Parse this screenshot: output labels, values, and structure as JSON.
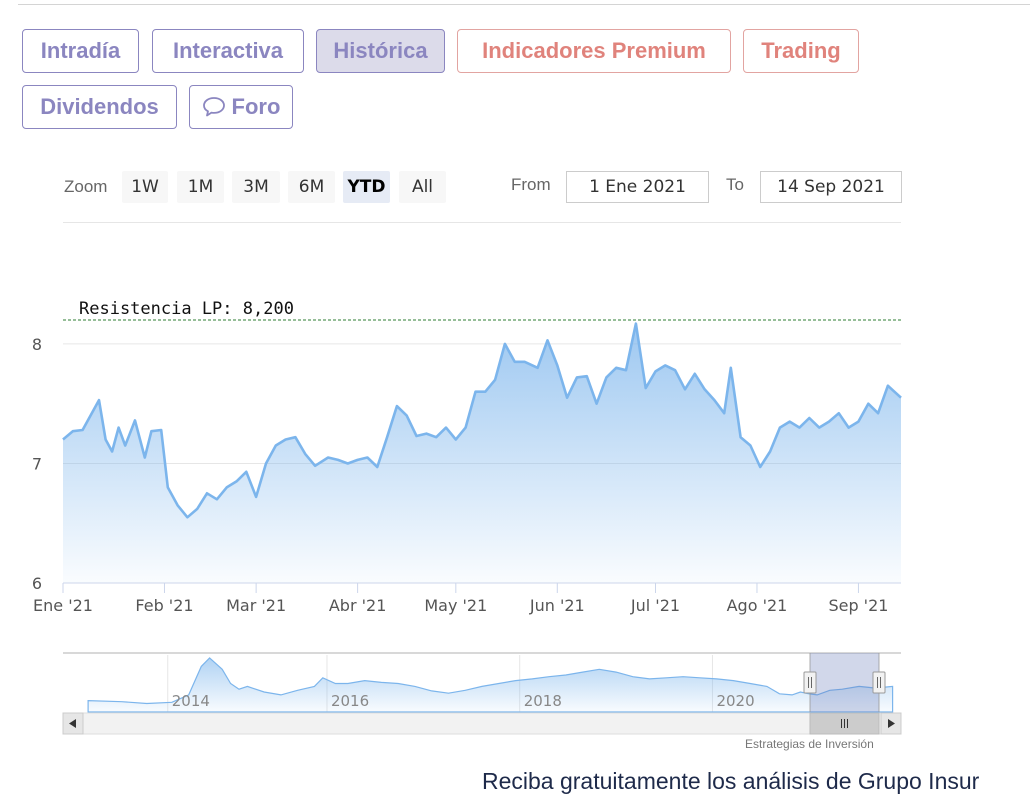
{
  "tabs": [
    {
      "label": "Intradía",
      "kind": "normal"
    },
    {
      "label": "Interactiva",
      "kind": "normal"
    },
    {
      "label": "Histórica",
      "kind": "active"
    },
    {
      "label": "Indicadores Premium",
      "kind": "premium"
    },
    {
      "label": "Trading",
      "kind": "premium"
    },
    {
      "label": "Dividendos",
      "kind": "normal"
    },
    {
      "label": "Foro",
      "kind": "normal",
      "icon": "chat-bubble-icon"
    }
  ],
  "range_selector": {
    "zoom_label": "Zoom",
    "buttons": [
      "1W",
      "1M",
      "3M",
      "6M",
      "YTD",
      "All"
    ],
    "selected": "YTD",
    "from_label": "From",
    "from_value": "1 Ene 2021",
    "to_label": "To",
    "to_value": "14 Sep 2021"
  },
  "chart_data": {
    "type": "area",
    "y_ticks": [
      "8",
      "7",
      "6"
    ],
    "x_ticks": [
      "Ene '21",
      "Feb '21",
      "Mar '21",
      "Abr '21",
      "May '21",
      "Jun '21",
      "Jul '21",
      "Ago '21",
      "Sep '21"
    ],
    "ylim": [
      6,
      8.2
    ],
    "resistance": {
      "label": "Resistencia LP: 8,200",
      "value": 8.2
    },
    "series": [
      {
        "x": [
          "2021-01-01",
          "2021-01-04",
          "2021-01-07",
          "2021-01-12",
          "2021-01-14",
          "2021-01-16",
          "2021-01-18",
          "2021-01-20",
          "2021-01-23",
          "2021-01-26",
          "2021-01-28",
          "2021-01-31",
          "2021-02-02",
          "2021-02-05",
          "2021-02-08",
          "2021-02-11",
          "2021-02-14",
          "2021-02-17",
          "2021-02-20",
          "2021-02-23",
          "2021-02-26",
          "2021-03-01",
          "2021-03-04",
          "2021-03-07",
          "2021-03-10",
          "2021-03-13",
          "2021-03-16",
          "2021-03-19",
          "2021-03-23",
          "2021-03-26",
          "2021-03-29",
          "2021-04-01",
          "2021-04-04",
          "2021-04-07",
          "2021-04-10",
          "2021-04-13",
          "2021-04-16",
          "2021-04-19",
          "2021-04-22",
          "2021-04-25",
          "2021-04-28",
          "2021-05-01",
          "2021-05-04",
          "2021-05-07",
          "2021-05-10",
          "2021-05-13",
          "2021-05-16",
          "2021-05-19",
          "2021-05-22",
          "2021-05-26",
          "2021-05-29",
          "2021-06-01",
          "2021-06-04",
          "2021-06-07",
          "2021-06-10",
          "2021-06-13",
          "2021-06-16",
          "2021-06-19",
          "2021-06-22",
          "2021-06-25",
          "2021-06-28",
          "2021-07-01",
          "2021-07-04",
          "2021-07-07",
          "2021-07-10",
          "2021-07-13",
          "2021-07-16",
          "2021-07-19",
          "2021-07-22",
          "2021-07-24",
          "2021-07-27",
          "2021-07-30",
          "2021-08-02",
          "2021-08-05",
          "2021-08-08",
          "2021-08-11",
          "2021-08-14",
          "2021-08-17",
          "2021-08-20",
          "2021-08-23",
          "2021-08-26",
          "2021-08-29",
          "2021-09-01",
          "2021-09-04",
          "2021-09-07",
          "2021-09-10",
          "2021-09-14"
        ],
        "y": [
          7.2,
          7.27,
          7.28,
          7.53,
          7.2,
          7.1,
          7.3,
          7.15,
          7.36,
          7.05,
          7.27,
          7.28,
          6.8,
          6.65,
          6.55,
          6.62,
          6.75,
          6.7,
          6.8,
          6.85,
          6.93,
          6.72,
          7.0,
          7.15,
          7.2,
          7.22,
          7.08,
          6.98,
          7.05,
          7.03,
          7.0,
          7.03,
          7.05,
          6.97,
          7.22,
          7.48,
          7.4,
          7.23,
          7.25,
          7.22,
          7.3,
          7.2,
          7.3,
          7.6,
          7.6,
          7.7,
          8.0,
          7.85,
          7.85,
          7.8,
          8.03,
          7.82,
          7.55,
          7.72,
          7.73,
          7.5,
          7.72,
          7.8,
          7.78,
          8.17,
          7.63,
          7.77,
          7.82,
          7.78,
          7.62,
          7.75,
          7.62,
          7.53,
          7.42,
          7.8,
          7.22,
          7.15,
          6.97,
          7.1,
          7.3,
          7.35,
          7.3,
          7.38,
          7.3,
          7.35,
          7.42,
          7.3,
          7.35,
          7.5,
          7.42,
          7.65,
          7.55
        ]
      }
    ]
  },
  "navigator": {
    "ticks": [
      "2014",
      "2016",
      "2018",
      "2020"
    ],
    "scroll_left_icon": "arrow-left-icon",
    "scroll_right_icon": "arrow-right-icon",
    "grip_icon": "grip-icon"
  },
  "credit": "Estrategias de Inversión",
  "footer": "Reciba gratuitamente los análisis de Grupo Insur"
}
